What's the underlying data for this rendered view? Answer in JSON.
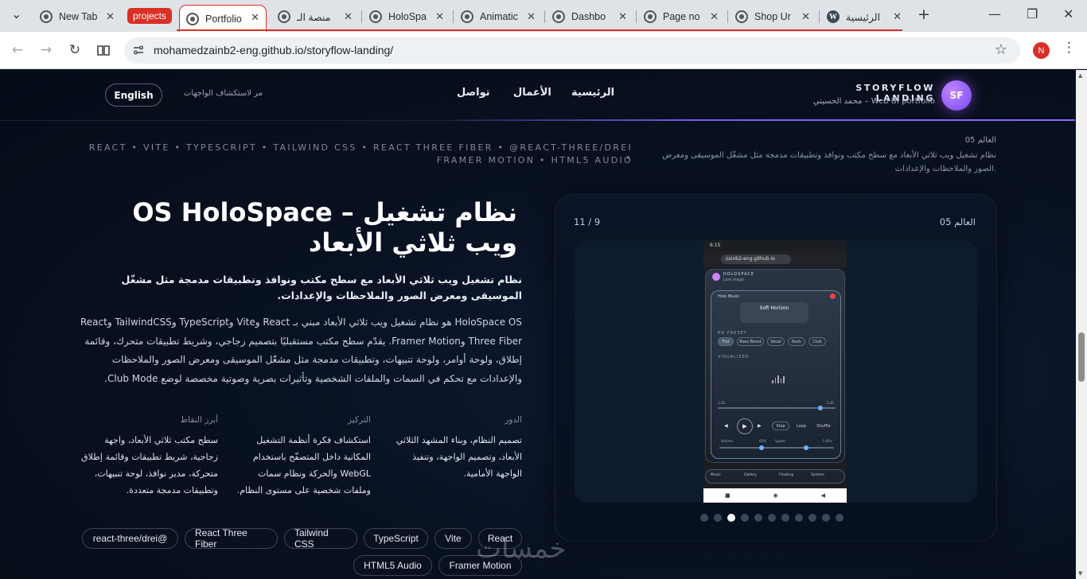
{
  "browser": {
    "tabs": [
      {
        "label": "New Tab"
      },
      {
        "label": "Portfolio"
      },
      {
        "label": "منصة الـ"
      },
      {
        "label": "HoloSpa"
      },
      {
        "label": "Animatic"
      },
      {
        "label": "Dashbo"
      },
      {
        "label": "Page no"
      },
      {
        "label": "Shop Ur"
      },
      {
        "label": "الرئيسية"
      }
    ],
    "group_label": "projects",
    "url": "mohamedzainb2-eng.github.io/storyflow-landing/",
    "profile_initial": "N"
  },
  "header": {
    "logo_text": "SF",
    "brand_title": "STORYFLOW LANDING",
    "brand_subtitle": "محمد الحسيني – Web UI portfolio",
    "nav": [
      "الرئيسية",
      "الأعمال",
      "تواصل"
    ],
    "tagline": "مر لاستكشاف الواجهات",
    "language_button": "English"
  },
  "hero": {
    "stack_line_1": "REACT • VITE • TYPESCRIPT • TAILWIND CSS • REACT THREE FIBER • @REACT-THREE/DREI •",
    "stack_line_2": "FRAMER MOTION • HTML5 AUDIO",
    "world_small": "العالم 05",
    "world_desc": "نظام تشغيل ويب ثلاثي الأبعاد مع سطح مكتب ونوافذ وتطبيقات مدمجة مثل مشغّل الموسيقى ومعرض الصور والملاحظات والإعدادات.",
    "title": "OS HoloSpace – نظام تشغيل ويب ثلاثي الأبعاد",
    "lead": "نظام تشغيل ويب ثلاثي الأبعاد مع سطح مكتب ونوافذ وتطبيقات مدمجة مثل مشغّل الموسيقى ومعرض الصور والملاحظات والإعدادات.",
    "body": "HoloSpace OS هو نظام تشغيل ويب ثلاثي الأبعاد مبني بـ React وVite وTypeScript وTailwindCSS وReact Three Fiber وFramer Motion. يقدّم سطح مكتب مستقبليًا بتصميم زجاجي، وشريط تطبيقات متحرك، وقائمة إطلاق، ولوحة أوامر، ولوحة تنبيهات، وتطبيقات مدمجة مثل مشغّل الموسيقى ومعرض الصور والملاحظات والإعدادات مع تحكم في السمات والملفات الشخصية وتأثيرات بصرية وصوتية مخصصة لوضع Club Mode."
  },
  "columns": [
    {
      "heading": "الدور",
      "text": "تصميم النظام، وبناء المشهد الثلاثي الأبعاد، وتصميم الواجهة، وتنفيذ الواجهة الأمامية."
    },
    {
      "heading": "التركيز",
      "text": "استكشاف فكرة أنظمة التشغيل المكانية داخل المتصفّح باستخدام WebGL والحركة ونظام سمات وملفات شخصية على مستوى النظام."
    },
    {
      "heading": "أبرز النقاط",
      "text": "سطح مكتب ثلاثي الأبعاد، واجهة زجاجية، شريط تطبيقات وقائمة إطلاق متحركة، مدير نوافذ، لوحة تنبيهات، وتطبيقات مدمجة متعددة."
    }
  ],
  "tech_chips": [
    "React",
    "Vite",
    "TypeScript",
    "Tailwind CSS",
    "React Three Fiber",
    "react-three/drei@",
    "Framer Motion",
    "HTML5 Audio"
  ],
  "preview": {
    "world": "العالم 05",
    "counter": "11 / 9",
    "dots_total": 11,
    "dots_active_index": 2,
    "phone": {
      "time": "6:15",
      "url": "zainb2-eng.github.io",
      "app_title": "HOLOSPACE",
      "app_sub": "Live stage",
      "player_name": "Holo Music",
      "track": "Soft Horizon",
      "eq_label": "EQ PRESET",
      "eq_presets": [
        "Flat",
        "Bass Boost",
        "Vocal",
        "Rock",
        "Club"
      ],
      "visualizer_label": "VISUALIZER",
      "time_start": "1:16",
      "time_end": "2:45",
      "controls": [
        "Stop",
        "Loop",
        "Shuffle"
      ],
      "volume_label": "Volume",
      "volume_value": "60%",
      "speed_label": "Speed",
      "speed_value": "1.00×",
      "dock": [
        "Music",
        "Gallery",
        "Floating",
        "System"
      ]
    }
  },
  "watermark": "خمسات"
}
